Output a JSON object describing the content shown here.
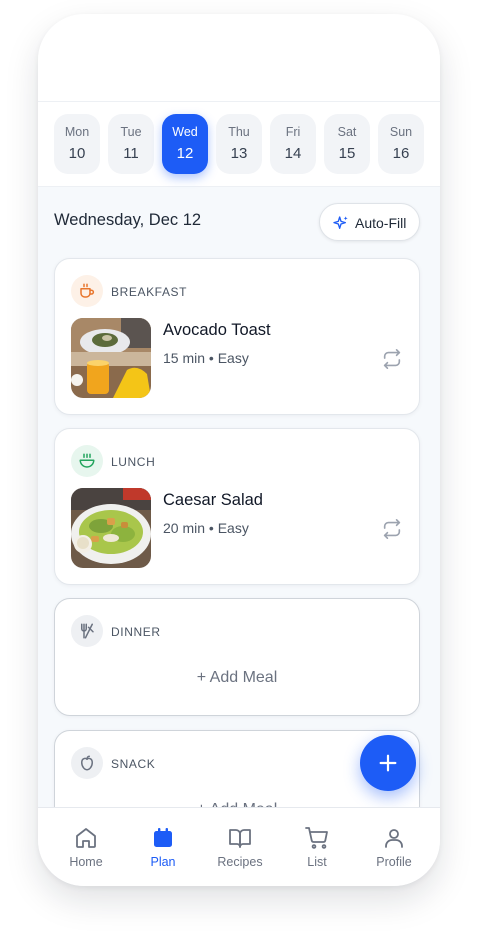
{
  "week": {
    "days": [
      {
        "name": "Mon",
        "num": "10"
      },
      {
        "name": "Tue",
        "num": "11"
      },
      {
        "name": "Wed",
        "num": "12"
      },
      {
        "name": "Thu",
        "num": "13"
      },
      {
        "name": "Fri",
        "num": "14"
      },
      {
        "name": "Sat",
        "num": "15"
      },
      {
        "name": "Sun",
        "num": "16"
      }
    ],
    "selected": "Wed"
  },
  "plan": {
    "date_heading": "Wednesday, Dec 12",
    "autofill_label": "Auto-Fill"
  },
  "meals": [
    {
      "label": "BREAKFAST",
      "icon": "coffee-cup-icon",
      "icon_color": "#e8762d",
      "recipe": "Avocado Toast",
      "meta": "15 min • Easy"
    },
    {
      "label": "LUNCH",
      "icon": "bowl-icon",
      "icon_color": "#22a45d",
      "recipe": "Caesar Salad",
      "meta": "20 min • Easy"
    },
    {
      "label": "DINNER",
      "icon": "utensils-icon",
      "icon_color": "#6b7280",
      "add_label": "+ Add Meal"
    },
    {
      "label": "SNACK",
      "icon": "apple-icon",
      "icon_color": "#6b7280",
      "add_label": "+ Add Meal"
    }
  ],
  "tabs": [
    {
      "label": "Home",
      "icon": "home-icon"
    },
    {
      "label": "Plan",
      "icon": "calendar-icon"
    },
    {
      "label": "Recipes",
      "icon": "book-icon"
    },
    {
      "label": "List",
      "icon": "cart-icon"
    },
    {
      "label": "Profile",
      "icon": "user-icon"
    }
  ],
  "colors": {
    "accent": "#1d5cf6",
    "background": "#f6f9fc"
  }
}
